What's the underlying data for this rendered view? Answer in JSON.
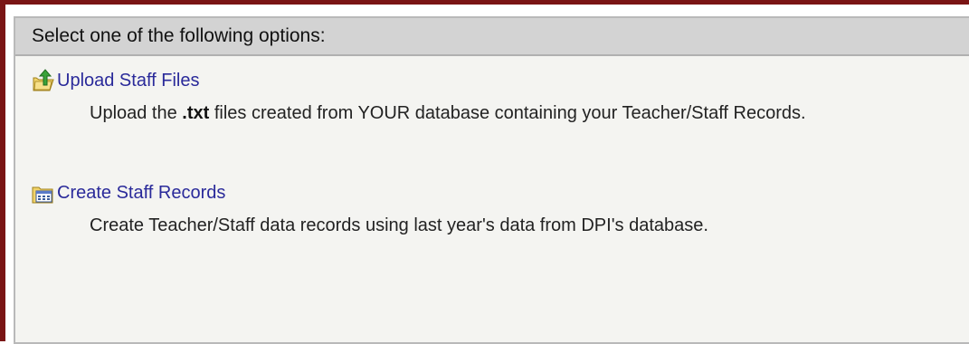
{
  "panel": {
    "header_title": "Select one of the following options:"
  },
  "options": [
    {
      "link_label": "Upload Staff Files",
      "icon": "upload-folder-icon",
      "desc_prefix": "Upload the ",
      "desc_bold": ".txt",
      "desc_suffix": " files created from YOUR database containing your Teacher/Staff Records."
    },
    {
      "link_label": "Create Staff Records",
      "icon": "calendar-folder-icon",
      "desc": "Create Teacher/Staff data records using last year's data from DPI's database."
    }
  ],
  "colors": {
    "frame_border": "#7a1515",
    "header_bg": "#d3d3d3",
    "panel_bg": "#f4f4f1",
    "link": "#2a2a9a"
  }
}
